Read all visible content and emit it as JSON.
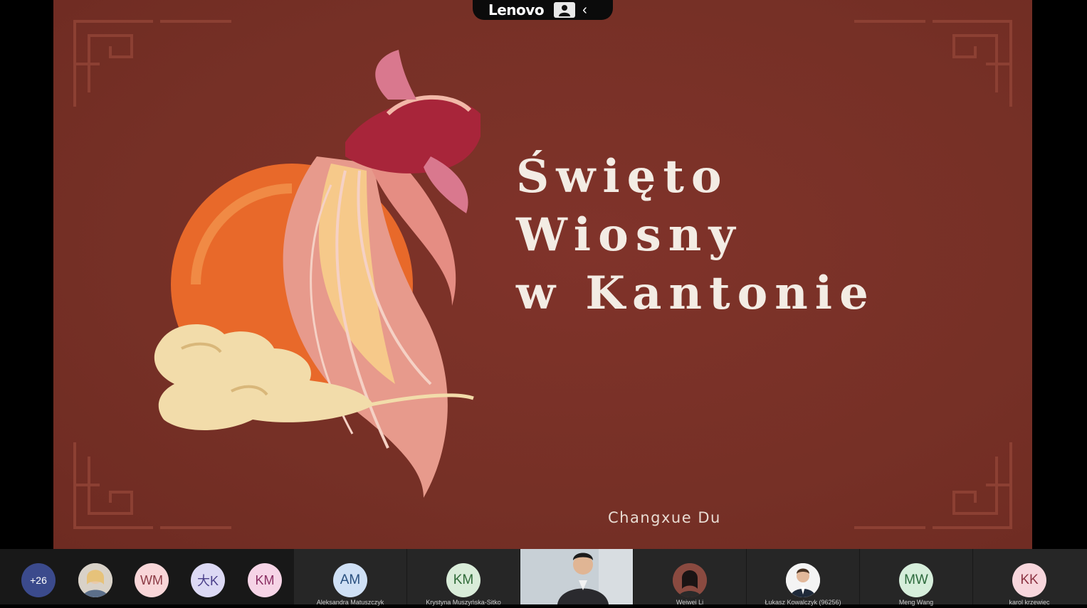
{
  "share_bar": {
    "brand": "Lenovo",
    "collapse_glyph": "‹"
  },
  "slide": {
    "title_lines": [
      "Święto",
      "Wiosny",
      "w Kantonie"
    ],
    "author": "Changxue Du",
    "colors": {
      "background": "#7a2e22",
      "text": "#f3ece4",
      "sun": "#e8692a",
      "cloud": "#f2dcaa"
    }
  },
  "participants": {
    "overflow_count": "+26",
    "avatars": [
      {
        "initials": "",
        "type": "photo"
      },
      {
        "initials": "WM",
        "color": "#f8d6d8",
        "text": "#8b3a44"
      },
      {
        "initials": "大K",
        "color": "#dcd9f4",
        "text": "#4a3f8a"
      },
      {
        "initials": "KM",
        "color": "#f6d4e6",
        "text": "#8a2e62"
      }
    ],
    "tiles": [
      {
        "initials": "AM",
        "color": "#cfe0f5",
        "text": "#29507f",
        "name": "Aleksandra Matuszczyk"
      },
      {
        "initials": "KM",
        "color": "#d9ecd9",
        "text": "#2f6a38",
        "name": "Krystyna Muszyńska-Sitko"
      },
      {
        "initials": "",
        "type": "video",
        "name": ""
      },
      {
        "initials": "",
        "type": "photo",
        "name": "Weiwei Li"
      },
      {
        "initials": "",
        "type": "photo",
        "name": "Łukasz Kowalczyk (96256)"
      },
      {
        "initials": "MW",
        "color": "#d6eedb",
        "text": "#2d6a3d",
        "name": "Meng Wang"
      },
      {
        "initials": "KK",
        "color": "#f7d6dc",
        "text": "#8b3342",
        "name": "karol krzewiec"
      }
    ]
  }
}
